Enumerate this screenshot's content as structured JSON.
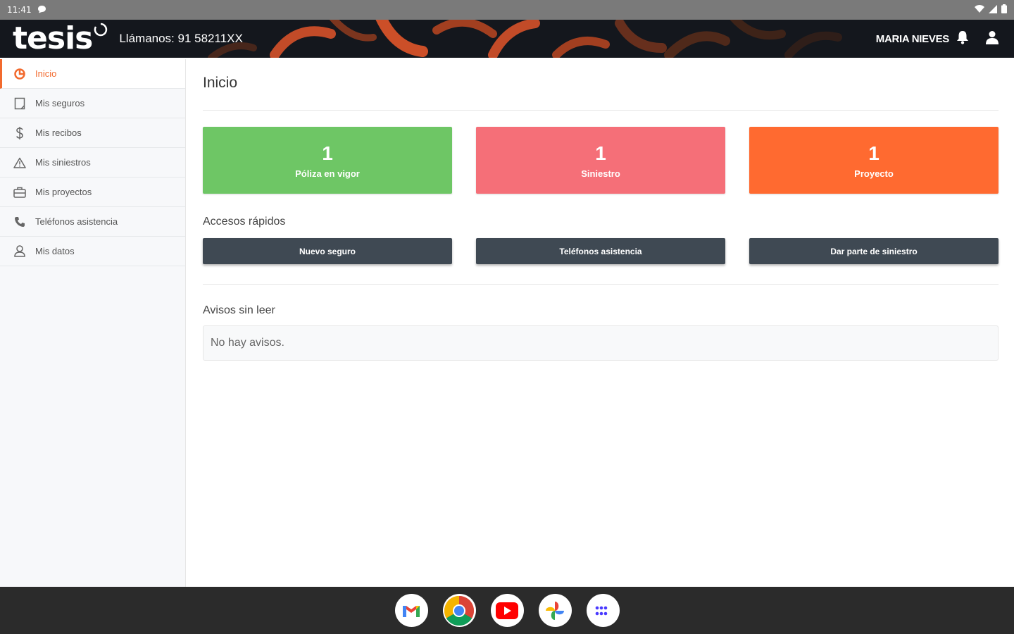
{
  "status_bar": {
    "time": "11:41"
  },
  "header": {
    "logo": "tesis",
    "phone": "Llámanos: 91 58211XX",
    "user_name": "MARIA NIEVES"
  },
  "sidebar": {
    "items": [
      {
        "label": "Inicio",
        "icon": "home-icon"
      },
      {
        "label": "Mis seguros",
        "icon": "document-icon"
      },
      {
        "label": "Mis recibos",
        "icon": "dollar-icon"
      },
      {
        "label": "Mis siniestros",
        "icon": "warning-icon"
      },
      {
        "label": "Mis proyectos",
        "icon": "briefcase-icon"
      },
      {
        "label": "Teléfonos asistencia",
        "icon": "phone-icon"
      },
      {
        "label": "Mis datos",
        "icon": "user-icon"
      }
    ],
    "active_index": 0
  },
  "main": {
    "title": "Inicio",
    "stats": [
      {
        "value": "1",
        "label": "Póliza en vigor",
        "color": "#6ec665"
      },
      {
        "value": "1",
        "label": "Siniestro",
        "color": "#f56f78"
      },
      {
        "value": "1",
        "label": "Proyecto",
        "color": "#ff6a30"
      }
    ],
    "quick_access": {
      "title": "Accesos rápidos",
      "buttons": [
        "Nuevo seguro",
        "Teléfonos asistencia",
        "Dar parte de siniestro"
      ]
    },
    "notices": {
      "title": "Avisos sin leer",
      "empty_text": "No hay avisos."
    }
  },
  "colors": {
    "accent": "#f26a2e",
    "header_bg": "#14171d",
    "button_bg": "#3f4953"
  },
  "dock": [
    "gmail-icon",
    "chrome-icon",
    "youtube-icon",
    "photos-icon",
    "app-drawer-icon"
  ]
}
